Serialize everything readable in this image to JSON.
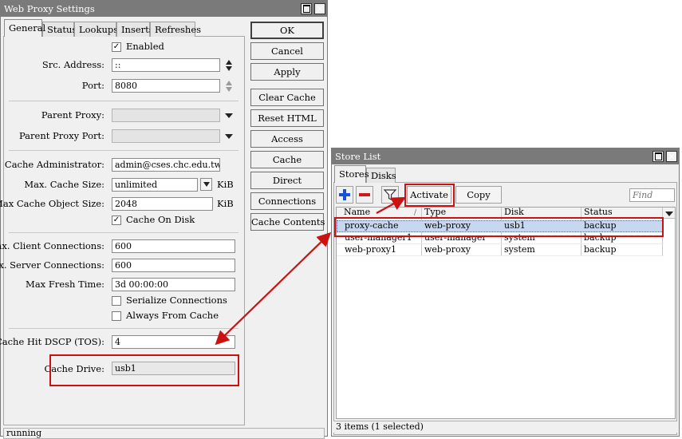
{
  "proxy_window": {
    "title": "Web Proxy Settings",
    "tabs": [
      "General",
      "Status",
      "Lookups",
      "Inserts",
      "Refreshes"
    ],
    "enabled": {
      "label": "Enabled",
      "checked": true
    },
    "src_address": {
      "label": "Src. Address:",
      "value": "::"
    },
    "port": {
      "label": "Port:",
      "value": "8080"
    },
    "parent_proxy": {
      "label": "Parent Proxy:",
      "value": ""
    },
    "parent_proxy_port": {
      "label": "Parent Proxy Port:",
      "value": ""
    },
    "cache_admin": {
      "label": "Cache Administrator:",
      "value": "admin@cses.chc.edu.tw"
    },
    "max_cache_size": {
      "label": "Max. Cache Size:",
      "value": "unlimited",
      "unit": "KiB"
    },
    "max_cache_object_size": {
      "label": "Max Cache Object Size:",
      "value": "2048",
      "unit": "KiB"
    },
    "cache_on_disk": {
      "label": "Cache On Disk",
      "checked": true
    },
    "max_client_connections": {
      "label": "Max. Client Connections:",
      "value": "600"
    },
    "max_server_connections": {
      "label": "Max. Server Connections:",
      "value": "600"
    },
    "max_fresh_time": {
      "label": "Max Fresh Time:",
      "value": "3d 00:00:00"
    },
    "serialize_connections": {
      "label": "Serialize Connections",
      "checked": false
    },
    "always_from_cache": {
      "label": "Always From Cache",
      "checked": false
    },
    "cache_hit_dscp": {
      "label": "Cache Hit DSCP (TOS):",
      "value": "4"
    },
    "cache_drive": {
      "label": "Cache Drive:",
      "value": "usb1"
    },
    "buttons": [
      "OK",
      "Cancel",
      "Apply",
      "Clear Cache",
      "Reset HTML",
      "Access",
      "Cache",
      "Direct",
      "Connections",
      "Cache Contents"
    ],
    "status": "running"
  },
  "store_window": {
    "title": "Store List",
    "tabs": [
      "Stores",
      "Disks"
    ],
    "toolbar": {
      "activate": "Activate",
      "copy": "Copy",
      "find_placeholder": "Find"
    },
    "columns": [
      "Name",
      "Type",
      "Disk",
      "Status"
    ],
    "rows": [
      {
        "name": "proxy-cache",
        "type": "web-proxy",
        "disk": "usb1",
        "status": "backup",
        "selected": true
      },
      {
        "name": "user-manager1",
        "type": "user-manager",
        "disk": "system",
        "status": "backup",
        "selected": false
      },
      {
        "name": "web-proxy1",
        "type": "web-proxy",
        "disk": "system",
        "status": "backup",
        "selected": false
      }
    ],
    "status": "3 items (1 selected)"
  },
  "annotation_color": "#cc1111"
}
